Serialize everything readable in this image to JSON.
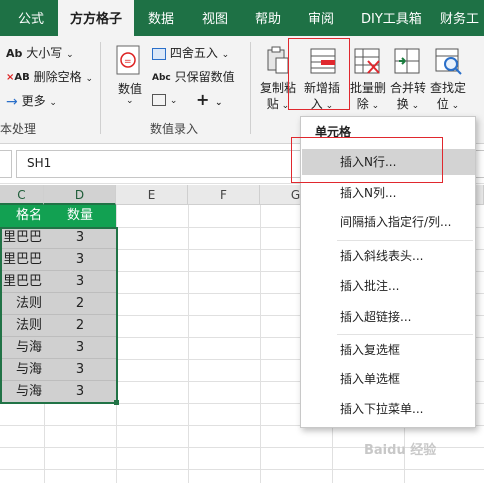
{
  "tabs": [
    {
      "label": "公式",
      "active": false
    },
    {
      "label": "方方格子",
      "active": true
    },
    {
      "label": "数据",
      "active": false
    },
    {
      "label": "视图",
      "active": false
    },
    {
      "label": "帮助",
      "active": false
    },
    {
      "label": "审阅",
      "active": false
    },
    {
      "label": "DIY工具箱",
      "active": false
    },
    {
      "label": "财务工",
      "active": false
    }
  ],
  "ribbon": {
    "text_group": {
      "case_label": "大小写",
      "remove_space_label": "删除空格",
      "more_label": "更多",
      "group_label": "本处理"
    },
    "numeric_group": {
      "value_label": "数值",
      "round_label": "四舍五入",
      "keep_value_label": "只保留数值",
      "group_label": "数值录入"
    },
    "edit_group": {
      "copy_paste_line1": "复制粘",
      "copy_paste_line2": "贴",
      "insert_line1": "新增插",
      "insert_line2": "入",
      "batch_delete_line1": "批量删",
      "batch_delete_line2": "除",
      "merge_line1": "合并转",
      "merge_line2": "换",
      "find_line1": "查找定",
      "find_line2": "位"
    }
  },
  "formula_bar": {
    "content": "SH1"
  },
  "columns": [
    "C",
    "D",
    "E",
    "F",
    "G"
  ],
  "table": {
    "header": {
      "name": "格名",
      "qty": "数量"
    },
    "rows": [
      {
        "name": "里巴巴",
        "qty": "3"
      },
      {
        "name": "里巴巴",
        "qty": "3"
      },
      {
        "name": "里巴巴",
        "qty": "3"
      },
      {
        "name": "法则",
        "qty": "2"
      },
      {
        "name": "法则",
        "qty": "2"
      },
      {
        "name": "与海",
        "qty": "3"
      },
      {
        "name": "与海",
        "qty": "3"
      },
      {
        "name": "与海",
        "qty": "3"
      }
    ]
  },
  "menu": {
    "section": "单元格",
    "items": [
      "插入N行...",
      "插入N列...",
      "间隔插入指定行/列...",
      "插入斜线表头...",
      "插入批注...",
      "插入超链接...",
      "插入复选框",
      "插入单选框",
      "插入下拉菜单..."
    ]
  },
  "watermark": "Baidu 经验",
  "colors": {
    "excel_green": "#1e7145",
    "header_green": "#12a152",
    "highlight_red": "#e0282e"
  }
}
